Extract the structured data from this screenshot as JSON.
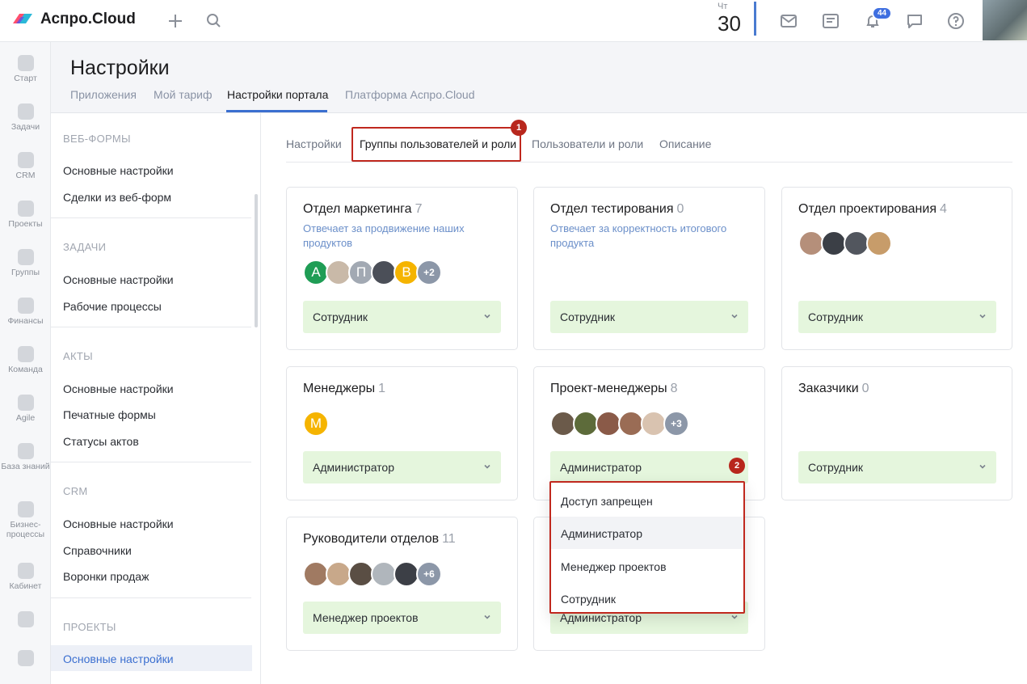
{
  "app": {
    "name": "Аспро.Cloud"
  },
  "topbar": {
    "day_label": "Чт",
    "day_number": "30",
    "notifications_count": "44",
    "icons": [
      "plus-icon",
      "search-icon",
      "mail-icon",
      "notes-icon",
      "bell-icon",
      "chat-icon",
      "help-icon"
    ]
  },
  "leftnav": [
    {
      "label": "Старт"
    },
    {
      "label": "Задачи"
    },
    {
      "label": "CRM"
    },
    {
      "label": "Проекты"
    },
    {
      "label": "Группы"
    },
    {
      "label": "Финансы"
    },
    {
      "label": "Команда"
    },
    {
      "label": "Agile"
    },
    {
      "label": "База знаний"
    },
    {
      "label": "Бизнес-процессы"
    },
    {
      "label": "Кабинет"
    }
  ],
  "header": {
    "title": "Настройки",
    "tabs": [
      {
        "label": "Приложения"
      },
      {
        "label": "Мой тариф"
      },
      {
        "label": "Настройки портала"
      },
      {
        "label": "Платформа Аспро.Cloud"
      }
    ]
  },
  "sidebar": {
    "sections": [
      {
        "title": "ВЕБ-ФОРМЫ",
        "items": [
          "Основные настройки",
          "Сделки из веб-форм"
        ]
      },
      {
        "title": "ЗАДАЧИ",
        "items": [
          "Основные настройки",
          "Рабочие процессы"
        ]
      },
      {
        "title": "АКТЫ",
        "items": [
          "Основные настройки",
          "Печатные формы",
          "Статусы актов"
        ]
      },
      {
        "title": "CRM",
        "items": [
          "Основные настройки",
          "Справочники",
          "Воронки продаж"
        ]
      },
      {
        "title": "ПРОЕКТЫ",
        "items": [
          "Основные настройки"
        ]
      }
    ]
  },
  "content": {
    "tabs": [
      {
        "label": "Настройки"
      },
      {
        "label": "Группы пользователей и роли"
      },
      {
        "label": "Пользователи и роли"
      },
      {
        "label": "Описание"
      }
    ],
    "annotations": [
      "1",
      "2"
    ],
    "groups": [
      {
        "name": "Отдел маркетинга",
        "count": "7",
        "description": "Отвечает за продвижение наших продуктов",
        "avatars": [
          "А",
          "",
          "П",
          "",
          "В"
        ],
        "more": "+2",
        "role": "Сотрудник"
      },
      {
        "name": "Отдел тестирования",
        "count": "0",
        "description": "Отвечает за корректность итогового продукта",
        "avatars": [],
        "more": "",
        "role": "Сотрудник"
      },
      {
        "name": "Отдел проектирования",
        "count": "4",
        "description": "",
        "avatars": [
          "",
          "",
          "",
          ""
        ],
        "more": "",
        "role": "Сотрудник"
      },
      {
        "name": "Менеджеры",
        "count": "1",
        "description": "",
        "avatars": [
          "М"
        ],
        "more": "",
        "role": "Администратор"
      },
      {
        "name": "Проект-менеджеры",
        "count": "8",
        "description": "",
        "avatars": [
          "",
          "",
          "",
          "",
          ""
        ],
        "more": "+3",
        "role": "Администратор"
      },
      {
        "name": "Заказчики",
        "count": "0",
        "description": "",
        "avatars": [],
        "more": "",
        "role": "Сотрудник"
      },
      {
        "name": "Руководители отделов",
        "count": "11",
        "description": "",
        "avatars": [
          "",
          "",
          "",
          "",
          ""
        ],
        "more": "+6",
        "role": "Менеджер проектов"
      },
      {
        "name": "",
        "count": "",
        "description": "",
        "avatars": [],
        "more": "",
        "role": "Администратор"
      }
    ],
    "dropdown": {
      "options": [
        "Доступ запрещен",
        "Администратор",
        "Менеджер проектов",
        "Сотрудник"
      ],
      "selected": "Администратор"
    }
  },
  "colors": {
    "accent": "#3b6fd0",
    "role_bg": "#e5f6dd",
    "annotation": "#c0281e",
    "badge": "#3f6fe0"
  }
}
